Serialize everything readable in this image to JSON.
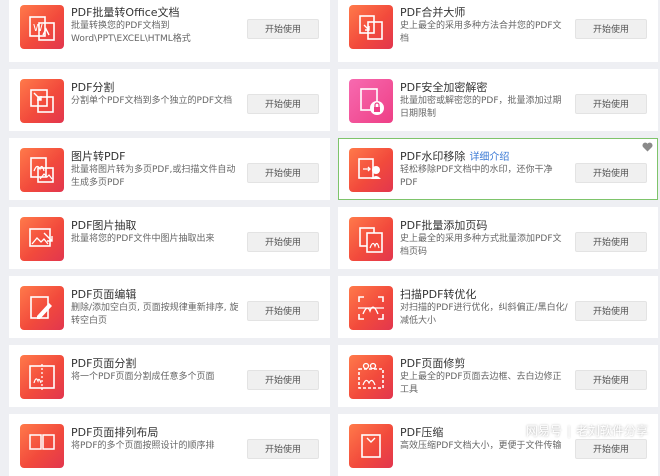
{
  "tools": [
    {
      "title": "PDF批量转Office文档",
      "desc": "批量转换您的PDF文档到Word\\PPT\\EXCEL\\HTML格式",
      "button": "开始使用",
      "icon": "pdf-to-office-icon"
    },
    {
      "title": "PDF合并大师",
      "desc": "史上最全的采用多种方法合并您的PDF文档",
      "button": "开始使用",
      "icon": "pdf-merge-icon"
    },
    {
      "title": "PDF分割",
      "desc": "分割单个PDF文档到多个独立的PDF文档",
      "button": "开始使用",
      "icon": "pdf-split-icon"
    },
    {
      "title": "PDF安全加密解密",
      "desc": "批量加密或解密您的PDF，批量添加过期日期限制",
      "button": "开始使用",
      "icon": "pdf-lock-icon"
    },
    {
      "title": "图片转PDF",
      "desc": "批量将图片转为多页PDF,或扫描文件自动生成多页PDF",
      "button": "开始使用",
      "icon": "image-to-pdf-icon"
    },
    {
      "title": "PDF水印移除",
      "link": "详细介绍",
      "desc": "轻松移除PDF文档中的水印，还你干净PDF",
      "button": "开始使用",
      "icon": "watermark-remove-icon"
    },
    {
      "title": "PDF图片抽取",
      "desc": "批量将您的PDF文件中图片抽取出来",
      "button": "开始使用",
      "icon": "image-extract-icon"
    },
    {
      "title": "PDF批量添加页码",
      "desc": "史上最全的采用多种方式批量添加PDF文档页码",
      "button": "开始使用",
      "icon": "page-number-icon"
    },
    {
      "title": "PDF页面编辑",
      "desc": "删除/添加空白页, 页面按规律重新排序, 旋转空白页",
      "button": "开始使用",
      "icon": "page-edit-icon"
    },
    {
      "title": "扫描PDF转优化",
      "desc": "对扫描的PDF进行优化，纠斜偏正/黑白化/减低大小",
      "button": "开始使用",
      "icon": "scan-optimize-icon"
    },
    {
      "title": "PDF页面分割",
      "desc": "将一个PDF页面分割成任意多个页面",
      "button": "开始使用",
      "icon": "page-split-icon"
    },
    {
      "title": "PDF页面修剪",
      "desc": "史上最全的PDF页面去边框、去白边修正工具",
      "button": "开始使用",
      "icon": "page-crop-icon"
    },
    {
      "title": "PDF页面排列布局",
      "desc": "将PDF的多个页面按照设计的顺序排",
      "button": "开始使用",
      "icon": "page-layout-icon"
    },
    {
      "title": "PDF压缩",
      "desc": "高效压缩PDF文档大小，更便于文件传输",
      "button": "开始使用",
      "icon": "compress-icon"
    }
  ],
  "watermark": {
    "platform": "网易号",
    "author": "老刘软件分享"
  },
  "colors": {
    "accent_orange": "#f24a3c",
    "accent_pink": "#ee3f86",
    "highlight_border": "#7ec46b",
    "link": "#3a79d4"
  }
}
